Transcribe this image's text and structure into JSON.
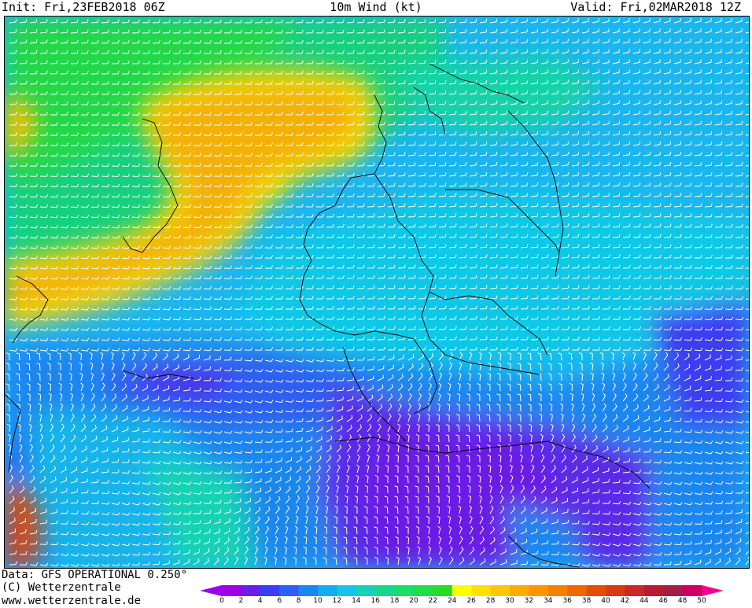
{
  "header": {
    "init": "Init: Fri,23FEB2018 06Z",
    "title": "10m Wind (kt)",
    "valid": "Valid: Fri,02MAR2018 12Z"
  },
  "footer": {
    "data_line": "Data: GFS OPERATIONAL 0.250°",
    "copyright": "(C) Wetterzentrale",
    "website": "www.wetterzentrale.de"
  },
  "legend": {
    "unit": "kt",
    "ticks": [
      "0",
      "2",
      "4",
      "6",
      "8",
      "10",
      "12",
      "14",
      "16",
      "18",
      "20",
      "22",
      "24",
      "26",
      "28",
      "30",
      "32",
      "34",
      "36",
      "38",
      "40",
      "42",
      "44",
      "46",
      "48",
      "50"
    ],
    "colors": [
      "#9b00e8",
      "#6a1fe4",
      "#3c3cf2",
      "#2d5ff0",
      "#1c86ef",
      "#16aaee",
      "#10c8e6",
      "#14d2b4",
      "#16d88c",
      "#1cdc6a",
      "#22dc48",
      "#28dc28",
      "#ffff00",
      "#ffe200",
      "#ffc800",
      "#ffac00",
      "#ff9600",
      "#f58000",
      "#ee6800",
      "#e05000",
      "#d43c14",
      "#c82828",
      "#b41e34",
      "#a01e48",
      "#c80064",
      "#f0008c"
    ]
  },
  "map": {
    "region": "Central Europe",
    "field": "10m wind speed with wind barbs",
    "prevailing_wind": "easterly"
  }
}
